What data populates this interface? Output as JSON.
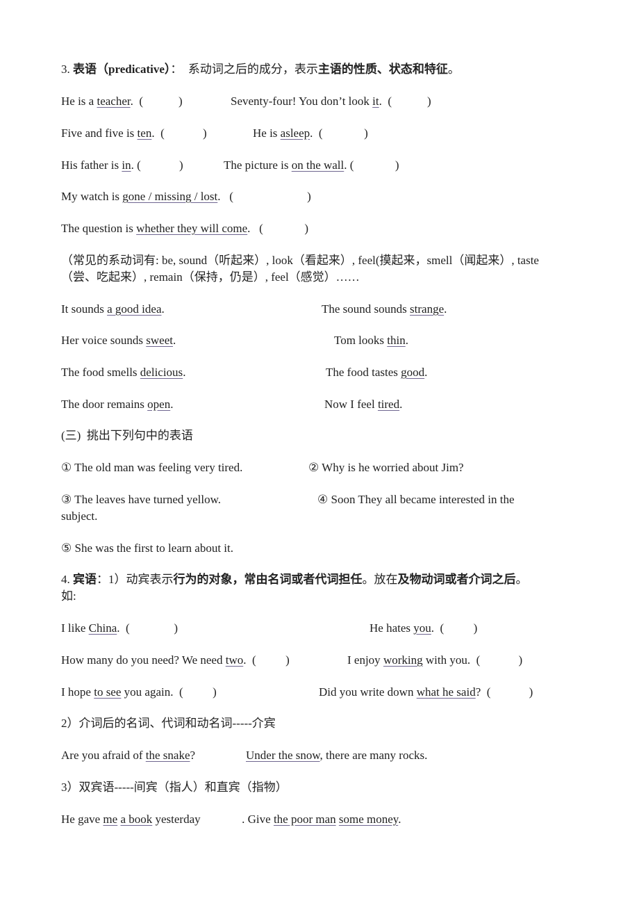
{
  "s3": {
    "heading": [
      {
        "t": "3. "
      },
      {
        "t": "表语（predicative）",
        "b": 1
      },
      {
        "t": "：  系动词之后的成分，表示"
      },
      {
        "t": "主语的性质、状态和特征",
        "b": 1
      },
      {
        "t": "。"
      }
    ],
    "ex": [
      [
        {
          "t": "He is a "
        },
        {
          "t": "teacher",
          "u": 1
        },
        {
          "t": ".  (            )"
        }
      ],
      [
        {
          "t": "Seventy-four! You don’t look "
        },
        {
          "t": "it",
          "u": 1
        },
        {
          "t": ".  (            )"
        }
      ],
      [
        {
          "t": "Five and five is "
        },
        {
          "t": "ten",
          "u": 1
        },
        {
          "t": ".  (             )"
        }
      ],
      [
        {
          "t": "He is "
        },
        {
          "t": "asleep",
          "u": 1
        },
        {
          "t": ".  (              )"
        }
      ],
      [
        {
          "t": "His father is "
        },
        {
          "t": "in",
          "u": 1
        },
        {
          "t": ". (             )"
        }
      ],
      [
        {
          "t": "The picture is "
        },
        {
          "t": "on the wall",
          "u": 1
        },
        {
          "t": ". (              )"
        }
      ],
      [
        {
          "t": "My watch is "
        },
        {
          "t": "gone / missing / lost",
          "u": 1
        },
        {
          "t": ".   (                         )"
        }
      ],
      [
        {
          "t": "The question is "
        },
        {
          "t": "whether they will come",
          "u": 1
        },
        {
          "t": ".   (              )"
        }
      ]
    ],
    "note1": "（常见的系动词有: be, sound（听起来）, look（看起来）, feel(摸起来，smell（闻起来）, taste",
    "note2": "（尝、吃起来）, remain（保持，仍是）, feel（感觉）……",
    "ex2": [
      [
        {
          "t": "It sounds "
        },
        {
          "t": "a good idea",
          "u": 1
        },
        {
          "t": "."
        }
      ],
      [
        {
          "t": "The sound sounds "
        },
        {
          "t": "strange",
          "u": 1
        },
        {
          "t": "."
        }
      ],
      [
        {
          "t": "Her voice sounds "
        },
        {
          "t": "sweet",
          "u": 1
        },
        {
          "t": "."
        }
      ],
      [
        {
          "t": "Tom looks "
        },
        {
          "t": "thin",
          "u": 1
        },
        {
          "t": "."
        }
      ],
      [
        {
          "t": "The food smells "
        },
        {
          "t": "delicious",
          "u": 1
        },
        {
          "t": "."
        }
      ],
      [
        {
          "t": "The food tastes "
        },
        {
          "t": "good",
          "u": 1
        },
        {
          "t": "."
        }
      ],
      [
        {
          "t": "The door remains "
        },
        {
          "t": "open",
          "u": 1
        },
        {
          "t": "."
        }
      ],
      [
        {
          "t": "Now I feel "
        },
        {
          "t": "tired",
          "u": 1
        },
        {
          "t": "."
        }
      ]
    ]
  },
  "ex3": {
    "heading": "(三)  挑出下列句中的表语",
    "items": [
      "① The old man was feeling very tired.",
      "② Why is he worried about Jim?",
      "③ The leaves have turned yellow.",
      "④ Soon They all became interested in the",
      "subject.",
      "⑤ She was the first to learn about it."
    ]
  },
  "s4": {
    "heading": [
      {
        "t": "4. "
      },
      {
        "t": "宾语",
        "b": 1
      },
      {
        "t": "：1）动宾表示"
      },
      {
        "t": "行为的对象，常由名词或者代词担任",
        "b": 1
      },
      {
        "t": "。放在"
      },
      {
        "t": "及物动词或者介词之后",
        "b": 1
      },
      {
        "t": "。"
      }
    ],
    "heading2": "如:",
    "ex": [
      [
        {
          "t": "I like "
        },
        {
          "t": "China",
          "u": 1
        },
        {
          "t": ".  (               )"
        }
      ],
      [
        {
          "t": "He hates "
        },
        {
          "t": "you",
          "u": 1
        },
        {
          "t": ".  (          )"
        }
      ],
      [
        {
          "t": "How many do you need? We need "
        },
        {
          "t": "two",
          "u": 1
        },
        {
          "t": ".  (          )"
        }
      ],
      [
        {
          "t": "I enjoy "
        },
        {
          "t": "working",
          "u": 1
        },
        {
          "t": " with you.  (             )"
        }
      ],
      [
        {
          "t": "I hope "
        },
        {
          "t": "to see",
          "u": 1
        },
        {
          "t": " you again.  (          )"
        }
      ],
      [
        {
          "t": "Did you write down "
        },
        {
          "t": "what he said",
          "u": 1
        },
        {
          "t": "?  (             )"
        }
      ]
    ],
    "sub2": "2）介词后的名词、代词和动名词-----介宾",
    "ex2": [
      [
        {
          "t": "Are you afraid of "
        },
        {
          "t": "the snake",
          "u": 1
        },
        {
          "t": "?"
        }
      ],
      [
        {
          "t": "Under the snow",
          "u": 1
        },
        {
          "t": ", there are many rocks."
        }
      ]
    ],
    "sub3": "3）双宾语-----间宾（指人）和直宾（指物）",
    "ex3": [
      {
        "t": "He gave "
      },
      {
        "t": "me",
        "u": 1
      },
      {
        "t": " "
      },
      {
        "t": "a book",
        "u": 1
      },
      {
        "t": " yesterday              . Give "
      },
      {
        "t": "the poor man",
        "u": 1
      },
      {
        "t": " "
      },
      {
        "t": "some money",
        "u": 1
      },
      {
        "t": "."
      }
    ]
  }
}
